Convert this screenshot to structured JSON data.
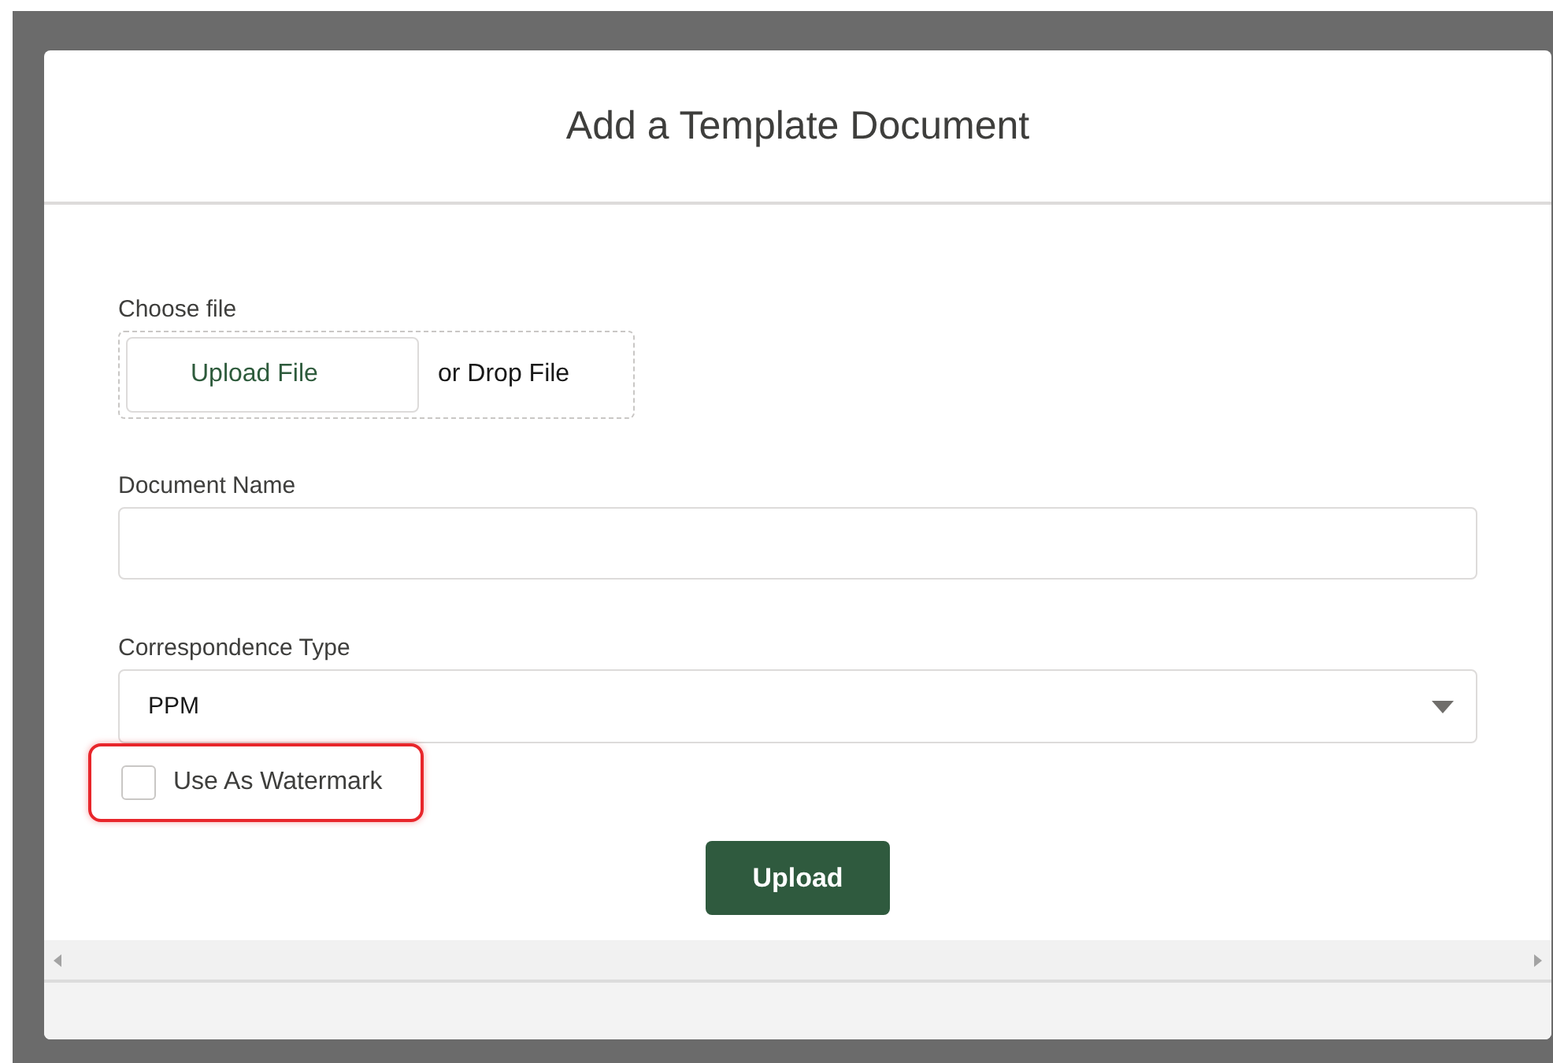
{
  "modal": {
    "title": "Add a Template Document"
  },
  "file_upload": {
    "label": "Choose file",
    "button": "Upload File",
    "drop_text": "or Drop File"
  },
  "document_name": {
    "label": "Document Name"
  },
  "correspondence_type": {
    "label": "Correspondence Type",
    "value": "PPM"
  },
  "watermark": {
    "label": "Use As Watermark",
    "checked": false,
    "highlighted": true
  },
  "submit": {
    "label": "Upload"
  }
}
